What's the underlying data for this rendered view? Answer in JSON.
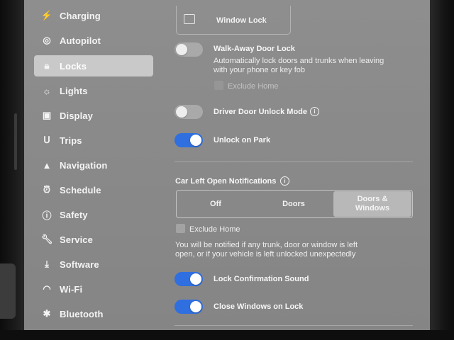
{
  "sidebar": {
    "items": [
      {
        "label": "Charging",
        "icon": "lightning-icon",
        "glyph": "⚡"
      },
      {
        "label": "Autopilot",
        "icon": "steering-wheel-icon",
        "glyph": "◎"
      },
      {
        "label": "Locks",
        "icon": "lock-icon",
        "glyph": "🔒︎"
      },
      {
        "label": "Lights",
        "icon": "sun-icon",
        "glyph": "☼"
      },
      {
        "label": "Display",
        "icon": "display-icon",
        "glyph": "▣"
      },
      {
        "label": "Trips",
        "icon": "trips-icon",
        "glyph": "ᑌ"
      },
      {
        "label": "Navigation",
        "icon": "navigation-arrow-icon",
        "glyph": "▲"
      },
      {
        "label": "Schedule",
        "icon": "alarm-clock-icon",
        "glyph": "⏰︎"
      },
      {
        "label": "Safety",
        "icon": "safety-alert-icon",
        "glyph": "ⓘ"
      },
      {
        "label": "Service",
        "icon": "wrench-icon",
        "glyph": "🔧︎"
      },
      {
        "label": "Software",
        "icon": "download-icon",
        "glyph": "⤓"
      },
      {
        "label": "Wi-Fi",
        "icon": "wifi-icon",
        "glyph": "◠"
      },
      {
        "label": "Bluetooth",
        "icon": "bluetooth-icon",
        "glyph": "✱"
      }
    ],
    "active": "Locks"
  },
  "locks": {
    "window_lock_label": "Window Lock",
    "walk_away": {
      "title": "Walk-Away Door Lock",
      "description_line1": "Automatically lock doors and trunks when leaving",
      "description_line2": "with your phone or key fob",
      "enabled": false,
      "exclude_home_label": "Exclude Home"
    },
    "driver_door_unlock": {
      "title": "Driver Door Unlock Mode",
      "enabled": false
    },
    "unlock_on_park": {
      "title": "Unlock on Park",
      "enabled": true
    },
    "car_left_open": {
      "title": "Car Left Open Notifications",
      "options": [
        "Off",
        "Doors",
        "Doors &",
        "Windows"
      ],
      "selected": "Doors & Windows",
      "exclude_home_label": "Exclude Home",
      "info_line1": "You will be notified if any trunk, door or window is left",
      "info_line2": "open, or if your vehicle is left unlocked unexpectedly"
    },
    "lock_confirmation_sound": {
      "title": "Lock Confirmation Sound",
      "enabled": true
    },
    "close_windows_on_lock": {
      "title": "Close Windows on Lock",
      "enabled": true
    }
  },
  "colors": {
    "toggle_on": "#2f6fe0",
    "toggle_off": "#a9a9a9",
    "screen_bg": "#8c8c8c",
    "active_nav": "#c9c9c9"
  }
}
